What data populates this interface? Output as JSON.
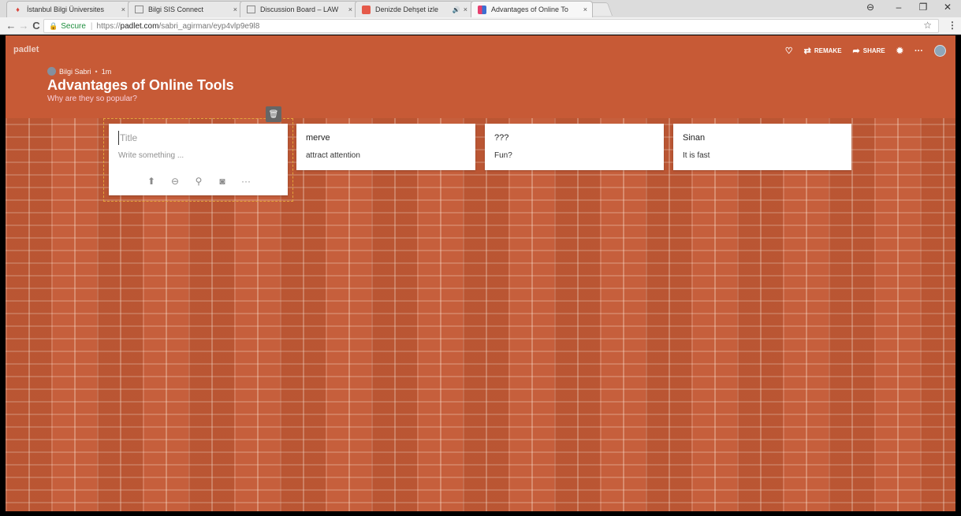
{
  "browser": {
    "tabs": [
      {
        "title": "İstanbul Bilgi Üniversites",
        "icon": "flame-icon",
        "active": false
      },
      {
        "title": "Bilgi SIS Connect",
        "icon": "page-icon",
        "active": false
      },
      {
        "title": "Discussion Board – LAW",
        "icon": "page-icon",
        "active": false
      },
      {
        "title": "Denizde Dehşet izle",
        "icon": "video-icon",
        "active": false
      },
      {
        "title": "Advantages of Online To",
        "icon": "padlet-icon",
        "active": true
      }
    ],
    "close_glyph": "×",
    "audio_glyph": "🔊",
    "window_controls": {
      "profile": "⊖",
      "minimize": "–",
      "restore": "❐",
      "close": "✕"
    },
    "address": {
      "secure_label": "Secure",
      "scheme": "https://",
      "host": "padlet.com",
      "path": "/sabri_agirman/eyp4vlp9e9l8"
    },
    "nav": {
      "back": "←",
      "forward": "→",
      "reload": "C"
    },
    "star": "☆",
    "menu": "⋮"
  },
  "padlet": {
    "brand": "padlet",
    "toolbar": {
      "remake_label": "REMAKE",
      "share_label": "SHARE",
      "more": "···",
      "like": "♡",
      "remake_icon": "⇄",
      "share_icon": "➦",
      "settings_icon": "✹"
    },
    "author": {
      "name": "Bilgi Sabri",
      "time": "1m"
    },
    "title": "Advantages of Online Tools",
    "subtitle": "Why are they so popular?",
    "editor": {
      "title_placeholder": "Title",
      "body_placeholder": "Write something ...",
      "tools": [
        "⬆",
        "⊖",
        "⚲",
        "◙",
        "···"
      ],
      "trash": "🗑"
    },
    "posts": [
      {
        "title": "merve",
        "body": "attract attention"
      },
      {
        "title": "???",
        "body": "Fun?"
      },
      {
        "title": "Sinan",
        "body": "It is fast"
      }
    ],
    "colors": {
      "wall": "#c45a36",
      "header": "#c75a36",
      "outline": "#e2a43c"
    }
  }
}
